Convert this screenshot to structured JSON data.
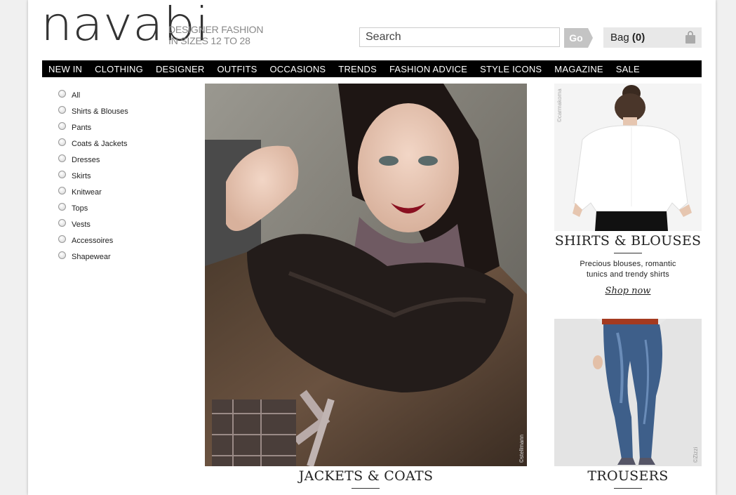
{
  "brand": {
    "logo_text": "navabi",
    "tagline_line1": "DESIGNER FASHION",
    "tagline_line2": "IN SIZES 12 TO 28"
  },
  "header": {
    "search_placeholder": "Search",
    "go_label": "Go",
    "bag_label": "Bag",
    "bag_count": "(0)"
  },
  "nav": {
    "items": [
      "NEW IN",
      "CLOTHING",
      "DESIGNER",
      "OUTFITS",
      "OCCASIONS",
      "TRENDS",
      "FASHION ADVICE",
      "STYLE ICONS",
      "MAGAZINE",
      "SALE"
    ]
  },
  "filters": {
    "items": [
      "All",
      "Shirts & Blouses",
      "Pants",
      "Coats & Jackets",
      "Dresses",
      "Skirts",
      "Knitwear",
      "Tops",
      "Vests",
      "Accessoires",
      "Shapewear"
    ]
  },
  "hero": {
    "photo_credit": "©stellmann",
    "title": "JACKETS & COATS"
  },
  "promo_shirts": {
    "photo_credit": "©carmakoma",
    "title": "SHIRTS & BLOUSES",
    "desc_line1": "Precious blouses, romantic",
    "desc_line2": "tunics and trendy shirts",
    "cta": "Shop now"
  },
  "promo_trousers": {
    "photo_credit": "©Zizzi",
    "title": "TROUSERS"
  },
  "colors": {
    "nav_bg": "#000000",
    "button_grey": "#c4c4c4",
    "bag_bg": "#e8e8e8"
  }
}
